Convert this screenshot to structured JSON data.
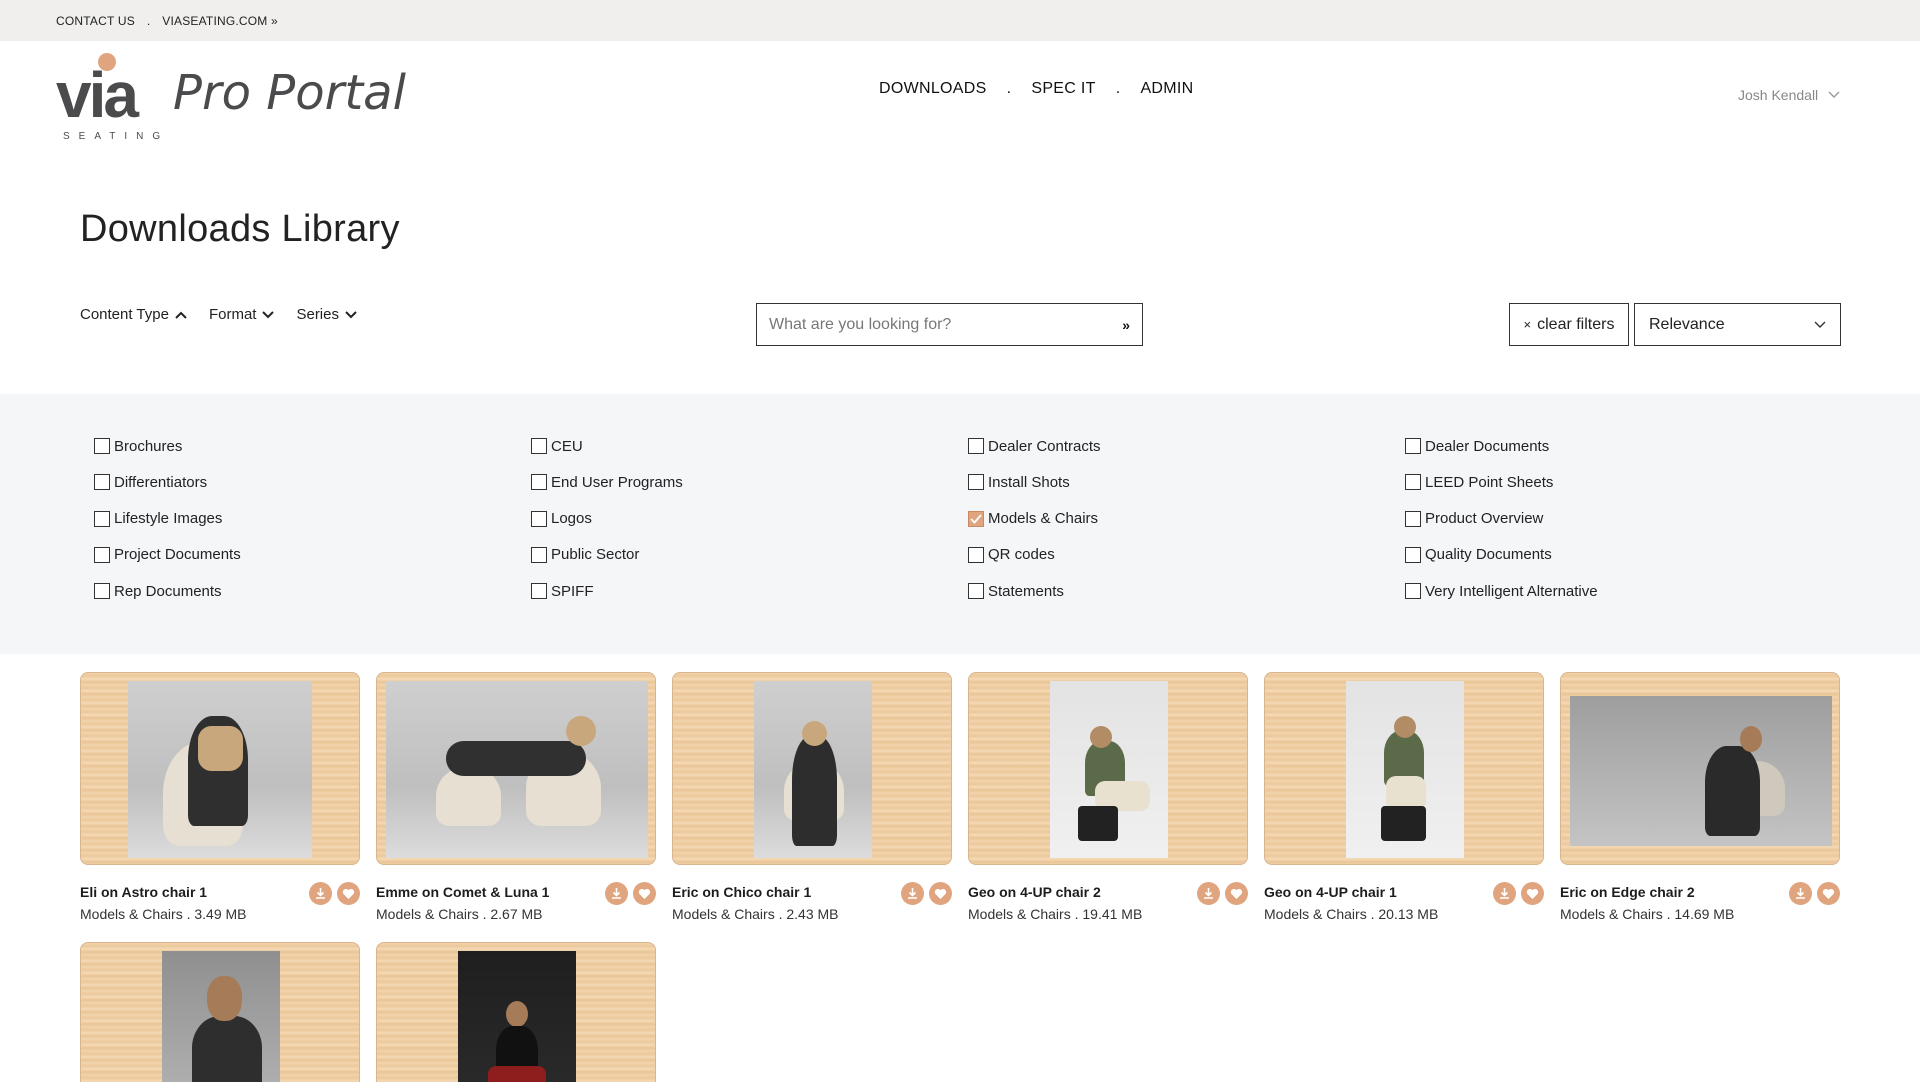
{
  "utility": {
    "contact": "CONTACT US",
    "separator": ".",
    "site": "VIASEATING.COM »"
  },
  "brand": {
    "logo_text": "via",
    "logo_sub": "SEATING",
    "portal": "Pro Portal",
    "accent": "#e0a57f"
  },
  "nav": {
    "items": [
      "DOWNLOADS",
      "SPEC IT",
      "ADMIN"
    ],
    "separator": "."
  },
  "user": {
    "name": "Josh Kendall"
  },
  "page": {
    "title": "Downloads Library"
  },
  "filters": {
    "toggles": [
      "Content Type",
      "Format",
      "Series"
    ],
    "search_placeholder": "What are you looking for?",
    "search_go": "»",
    "clear_icon": "×",
    "clear_label": "clear filters",
    "sort_value": "Relevance"
  },
  "content_types": [
    {
      "label": "Brochures",
      "checked": false
    },
    {
      "label": "CEU",
      "checked": false
    },
    {
      "label": "Dealer Contracts",
      "checked": false
    },
    {
      "label": "Dealer Documents",
      "checked": false
    },
    {
      "label": "Differentiators",
      "checked": false
    },
    {
      "label": "End User Programs",
      "checked": false
    },
    {
      "label": "Install Shots",
      "checked": false
    },
    {
      "label": "LEED Point Sheets",
      "checked": false
    },
    {
      "label": "Lifestyle Images",
      "checked": false
    },
    {
      "label": "Logos",
      "checked": false
    },
    {
      "label": "Models & Chairs",
      "checked": true
    },
    {
      "label": "Product Overview",
      "checked": false
    },
    {
      "label": "Project Documents",
      "checked": false
    },
    {
      "label": "Public Sector",
      "checked": false
    },
    {
      "label": "QR codes",
      "checked": false
    },
    {
      "label": "Quality Documents",
      "checked": false
    },
    {
      "label": "Rep Documents",
      "checked": false
    },
    {
      "label": "SPIFF",
      "checked": false
    },
    {
      "label": "Statements",
      "checked": false
    },
    {
      "label": "Very Intelligent Alternative",
      "checked": false
    }
  ],
  "products": [
    {
      "title": "Eli on Astro chair 1",
      "meta": "Models & Chairs . 3.49 MB"
    },
    {
      "title": "Emme on Comet & Luna 1",
      "meta": "Models & Chairs . 2.67 MB"
    },
    {
      "title": "Eric on Chico chair 1",
      "meta": "Models & Chairs . 2.43 MB"
    },
    {
      "title": "Geo on 4-UP chair 2",
      "meta": "Models & Chairs . 19.41 MB"
    },
    {
      "title": "Geo on 4-UP chair 1",
      "meta": "Models & Chairs . 20.13 MB"
    },
    {
      "title": "Eric on Edge chair 2",
      "meta": "Models & Chairs . 14.69 MB"
    }
  ]
}
